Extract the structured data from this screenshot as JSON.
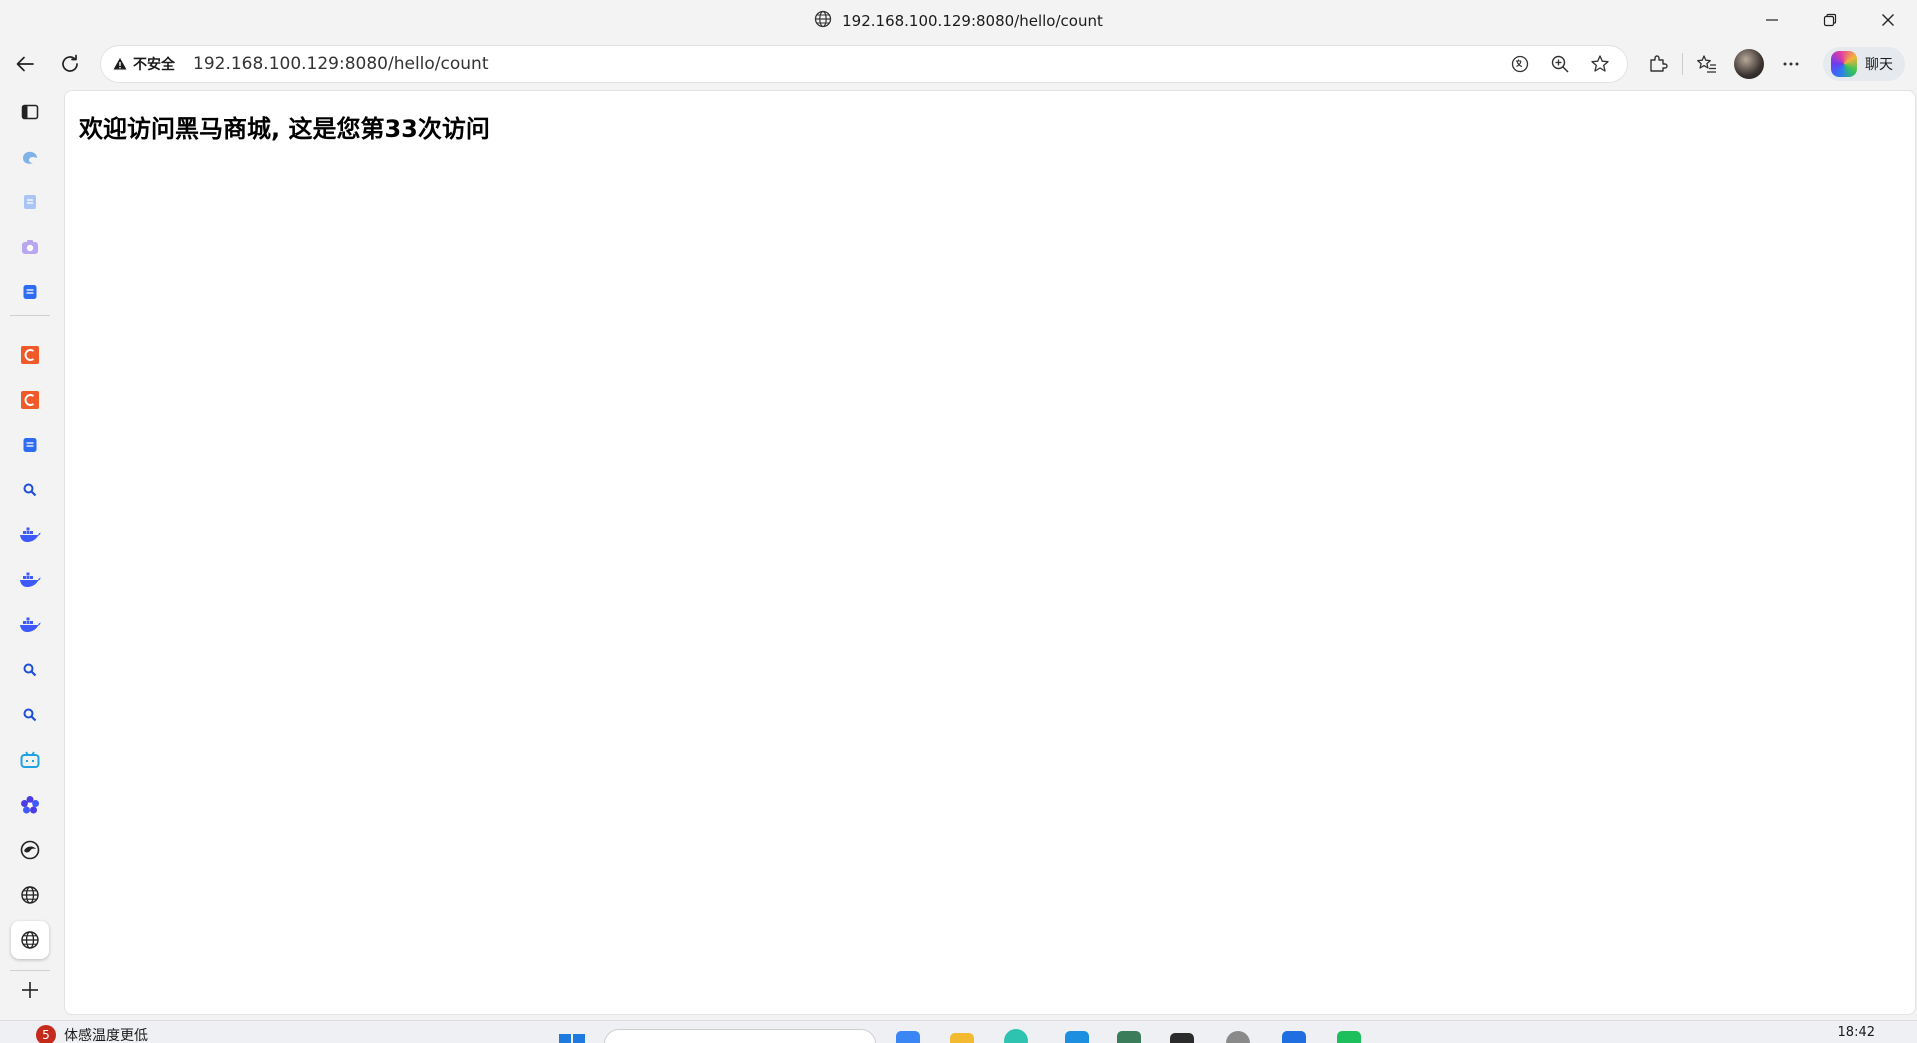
{
  "window": {
    "title": "192.168.100.129:8080/hello/count"
  },
  "toolbar": {
    "security_label": "不安全",
    "url": "192.168.100.129:8080/hello/count",
    "chat_label": "聊天"
  },
  "page": {
    "heading": "欢迎访问黑马商城, 这是您第33次访问"
  },
  "sidebar": {
    "items": [
      {
        "icon": "tab-actions-icon"
      },
      {
        "icon": "edge-shopping-icon"
      },
      {
        "icon": "document-icon"
      },
      {
        "icon": "screenshot-icon"
      },
      {
        "icon": "notes-icon"
      },
      {
        "icon": "c-app-icon"
      },
      {
        "icon": "c-app-icon"
      },
      {
        "icon": "notes-icon"
      },
      {
        "icon": "search-icon"
      },
      {
        "icon": "docker-icon"
      },
      {
        "icon": "docker-icon"
      },
      {
        "icon": "docker-icon"
      },
      {
        "icon": "search-icon"
      },
      {
        "icon": "search-icon"
      },
      {
        "icon": "bilibili-icon"
      },
      {
        "icon": "flower-app-icon"
      },
      {
        "icon": "circle-app-icon"
      },
      {
        "icon": "globe-icon"
      },
      {
        "icon": "globe-icon"
      },
      {
        "icon": "add-icon"
      }
    ]
  },
  "taskbar": {
    "weather_badge": "5",
    "weather_text": "体感温度更低",
    "clock": "18:42"
  },
  "colors": {
    "accent": "#0f6cbd",
    "c_app": "#f05a28",
    "docker": "#3d5afe",
    "frame": "#f3f3f3"
  }
}
